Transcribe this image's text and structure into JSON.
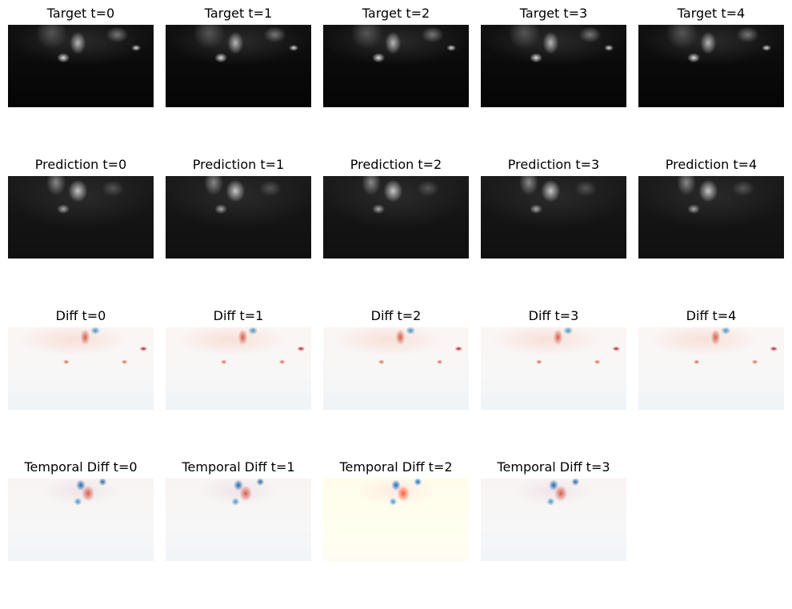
{
  "chart_data": {
    "type": "heatmap",
    "grid": false,
    "colormaps": {
      "Target": "gray",
      "Prediction": "gray",
      "Diff": "RdBu",
      "Temporal Diff": "RdBu"
    },
    "rows": [
      {
        "kind": "target",
        "titles": [
          "Target t=0",
          "Target t=1",
          "Target t=2",
          "Target t=3",
          "Target t=4"
        ]
      },
      {
        "kind": "pred",
        "titles": [
          "Prediction t=0",
          "Prediction t=1",
          "Prediction t=2",
          "Prediction t=3",
          "Prediction t=4"
        ]
      },
      {
        "kind": "diff",
        "titles": [
          "Diff t=0",
          "Diff t=1",
          "Diff t=2",
          "Diff t=3",
          "Diff t=4"
        ]
      },
      {
        "kind": "tdiff",
        "titles": [
          "Temporal Diff t=0",
          "Temporal Diff t=1",
          "Temporal Diff t=2",
          "Temporal Diff t=3"
        ]
      }
    ]
  }
}
